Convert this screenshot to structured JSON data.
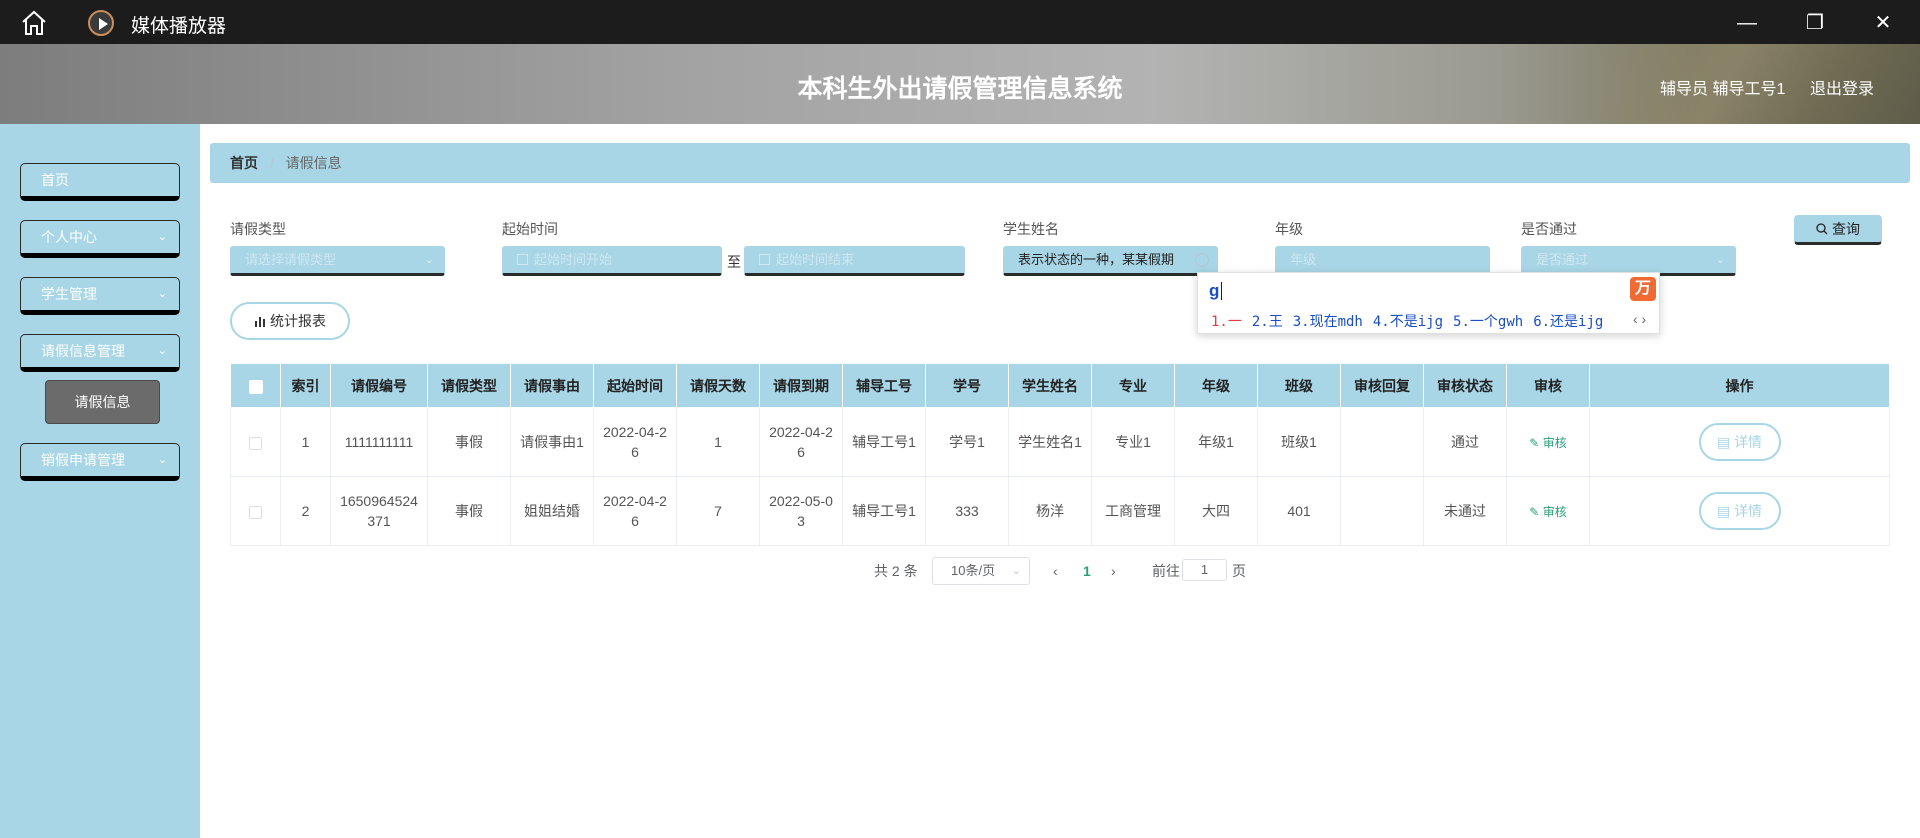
{
  "titlebar": {
    "title": "媒体播放器",
    "home_icon": "home-icon",
    "minimize": "—",
    "maximize": "❐",
    "close": "✕"
  },
  "header": {
    "title": "本科生外出请假管理信息系统",
    "user": "辅导员 辅导工号1",
    "logout": "退出登录"
  },
  "sidebar": {
    "items": [
      {
        "label": "首页"
      },
      {
        "label": "个人中心"
      },
      {
        "label": "学生管理"
      },
      {
        "label": "请假信息管理"
      },
      {
        "label": "销假申请管理"
      }
    ],
    "sub_item": "请假信息",
    "arrow": "⌄"
  },
  "breadcrumb": {
    "home": "首页",
    "sep": "/",
    "current": "请假信息"
  },
  "search": {
    "type_label": "请假类型",
    "type_placeholder": "请选择请假类型",
    "start_label": "起始时间",
    "start_placeholder": "起始时间开始",
    "to": "至",
    "end_placeholder": "起始时间结束",
    "name_label": "学生姓名",
    "name_value": "表示状态的一种，某某假期",
    "grade_label": "年级",
    "grade_placeholder": "年级",
    "pass_label": "是否通过",
    "pass_placeholder": "是否通过",
    "query_button": "查询",
    "stat_button": "统计报表"
  },
  "ime": {
    "input": "g",
    "logo": "万",
    "candidates": [
      "1.一",
      "2.王",
      "3.现在mdh",
      "4.不是ijg",
      "5.一个gwh",
      "6.还是ijg"
    ],
    "nav": "‹ ›"
  },
  "table": {
    "headers": [
      "索引",
      "请假编号",
      "请假类型",
      "请假事由",
      "起始时间",
      "请假天数",
      "请假到期",
      "辅导工号",
      "学号",
      "学生姓名",
      "专业",
      "年级",
      "班级",
      "审核回复",
      "审核状态",
      "审核",
      "操作"
    ],
    "rows": [
      {
        "index": "1",
        "no": "1111111111",
        "type": "事假",
        "reason": "请假事由1",
        "start": "2022-04-26",
        "days": "1",
        "due": "2022-04-26",
        "tutor": "辅导工号1",
        "sid": "学号1",
        "name": "学生姓名1",
        "major": "专业1",
        "grade": "年级1",
        "class": "班级1",
        "reply": "",
        "status": "通过",
        "audit": "审核",
        "detail": "详情"
      },
      {
        "index": "2",
        "no": "1650964524371",
        "type": "事假",
        "reason": "姐姐结婚",
        "start": "2022-04-26",
        "days": "7",
        "due": "2022-05-03",
        "tutor": "辅导工号1",
        "sid": "333",
        "name": "杨洋",
        "major": "工商管理",
        "grade": "大四",
        "class": "401",
        "reply": "",
        "status": "未通过",
        "audit": "审核",
        "detail": "详情"
      }
    ]
  },
  "pagination": {
    "total": "共 2 条",
    "page_size": "10条/页",
    "prev": "‹",
    "current": "1",
    "next": "›",
    "goto_label": "前往",
    "goto_value": "1",
    "goto_unit": "页"
  }
}
